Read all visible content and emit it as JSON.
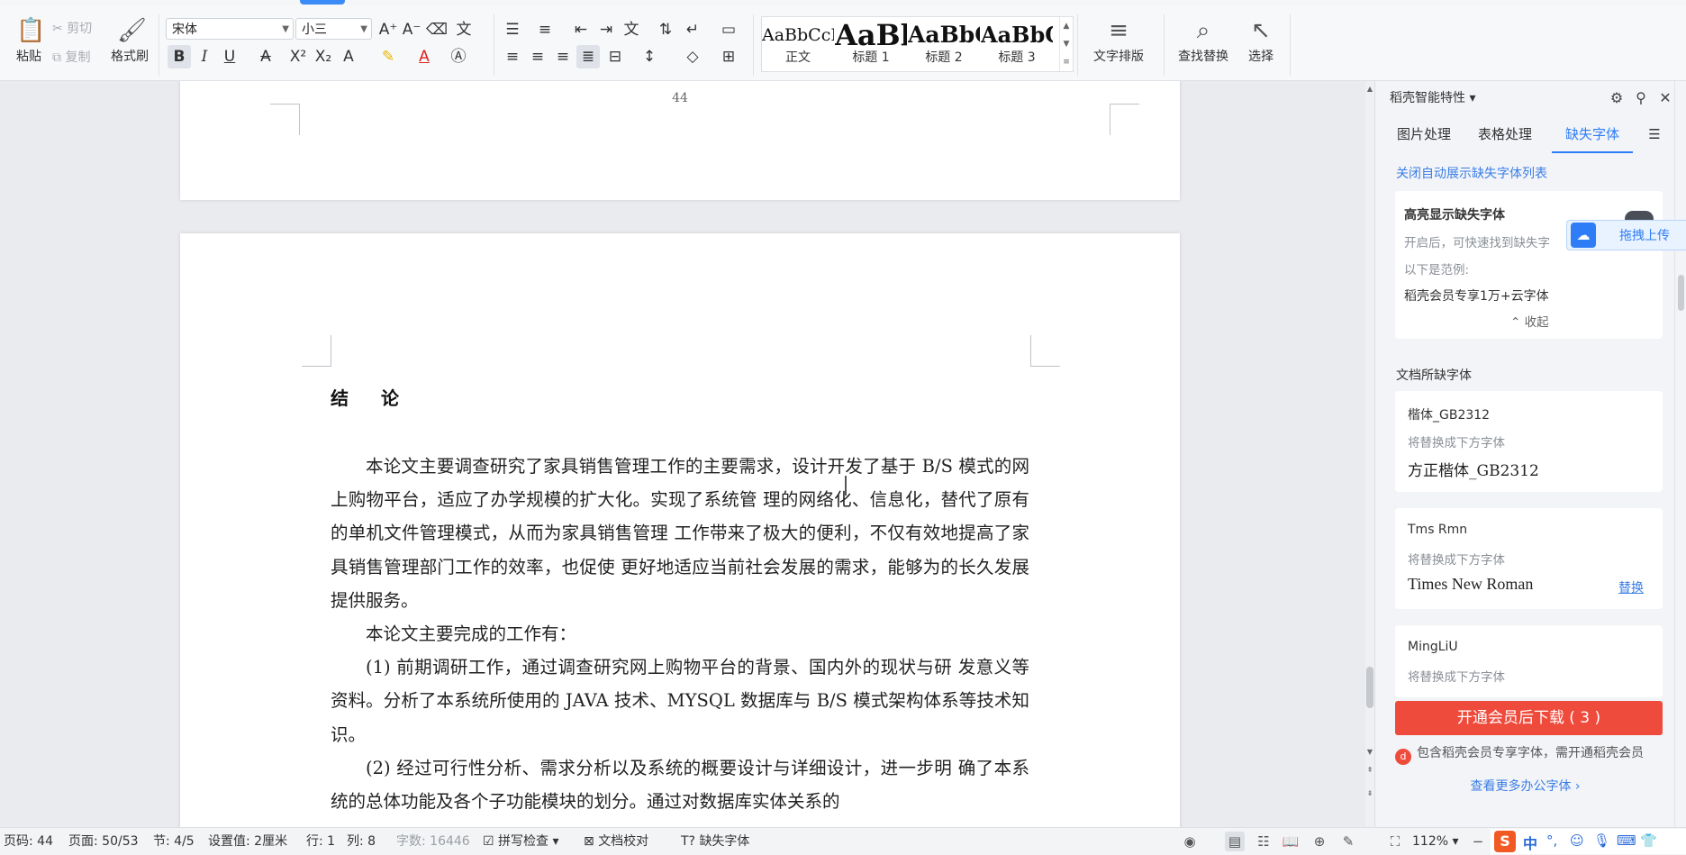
{
  "ribbon": {
    "paste": "粘贴",
    "cut": "剪切",
    "copy": "复制",
    "format_painter": "格式刷",
    "font_name": "宋体",
    "font_size": "小三",
    "text_layout": "文字排版",
    "find_replace": "查找替换",
    "select": "选择",
    "styles": [
      {
        "sample": "AaBbCcI",
        "name": "正文"
      },
      {
        "sample": "AaBl",
        "name": "标题 1"
      },
      {
        "sample": "AaBbC",
        "name": "标题 2"
      },
      {
        "sample": "AaBbC",
        "name": "标题 3"
      }
    ]
  },
  "document": {
    "page_number": "44",
    "heading": "结　论",
    "paragraphs": [
      "本论文主要调查研究了家具销售管理工作的主要需求，设计开发了基于 B/S 模式的网上购物平台，适应了办学规模的扩大化。实现了系统管 理的网络化、信息化，替代了原有的单机文件管理模式，从而为家具销售管理 工作带来了极大的便利，不仅有效地提高了家具销售管理部门工作的效率，也促使 更好地适应当前社会发展的需求，能够为的长久发展提供服务。",
      "本论文主要完成的工作有：",
      "(1) 前期调研工作，通过调查研究网上购物平台的背景、国内外的现状与研 发意义等资料。分析了本系统所使用的 JAVA 技术、MYSQL 数据库与 B/S 模式架构体系等技术知识。",
      "(2) 经过可行性分析、需求分析以及系统的概要设计与详细设计，进一步明 确了本系统的总体功能及各个子功能模块的划分。通过对数据库实体关系的"
    ]
  },
  "panel": {
    "title": "稻壳智能特性",
    "tabs": [
      "图片处理",
      "表格处理",
      "缺失字体"
    ],
    "close_auto_link": "关闭自动展示缺失字体列表",
    "highlight_card": {
      "title": "高亮显示缺失字体",
      "desc": "开启后，可快速找到缺失字",
      "example_label": "以下是范例:",
      "example_text": "稻壳会员专享1万+云字体",
      "collapse": "收起"
    },
    "upload_label": "拖拽上传",
    "missing_title": "文档所缺字体",
    "fonts": [
      {
        "name": "楷体_GB2312",
        "hint": "将替换成下方字体",
        "replacement": "方正楷体_GB2312",
        "action": ""
      },
      {
        "name": "Tms Rmn",
        "hint": "将替换成下方字体",
        "replacement": "Times New Roman",
        "action": "替换"
      },
      {
        "name": "MingLiU",
        "hint": "将替换成下方字体",
        "replacement": "",
        "action": ""
      }
    ],
    "cta": "开通会员后下载 ( 3 )",
    "note": "包含稻壳会员专享字体，需开通稻壳会员",
    "more": "查看更多办公字体 ›"
  },
  "status": {
    "page_code": "页码: 44",
    "page": "页面: 50/53",
    "section": "节: 4/5",
    "setting": "设置值: 2厘米",
    "row": "行: 1",
    "col": "列: 8",
    "word_count": "字数: 16446",
    "spell_check": "拼写检查",
    "doc_proof": "文档校对",
    "missing_font": "缺失字体",
    "zoom": "112%",
    "ime_lang": "中"
  }
}
